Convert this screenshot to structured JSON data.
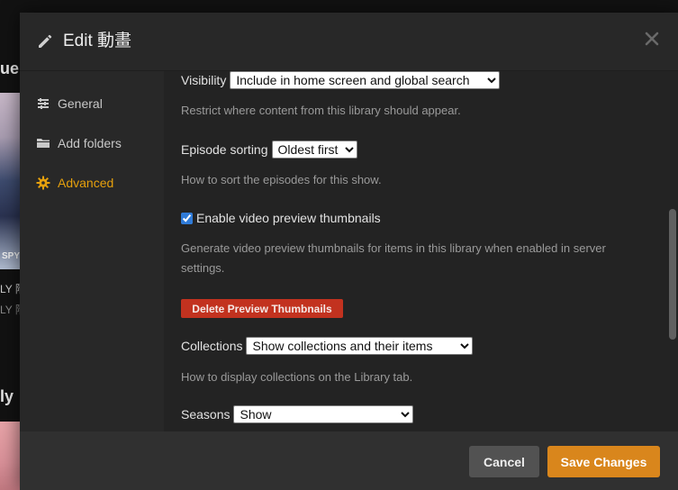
{
  "background": {
    "fragment_1": "ue",
    "fragment_2": "ly",
    "caption_1": "LY 階",
    "caption_2": "LY 階",
    "poster_text": "SPY"
  },
  "modal": {
    "title": "Edit 動畫",
    "title_icon": "pencil-icon",
    "close_icon": "close-icon"
  },
  "sidebar": {
    "items": [
      {
        "label": "General",
        "icon": "sliders-icon",
        "active": false
      },
      {
        "label": "Add folders",
        "icon": "folder-icon",
        "active": false
      },
      {
        "label": "Advanced",
        "icon": "gear-icon",
        "active": true
      }
    ]
  },
  "advanced": {
    "visibility": {
      "label": "Visibility",
      "value": "Include in home screen and global search",
      "help": "Restrict where content from this library should appear."
    },
    "episode_sorting": {
      "label": "Episode sorting",
      "value": "Oldest first",
      "help": "How to sort the episodes for this show."
    },
    "preview_thumbnails": {
      "label": "Enable video preview thumbnails",
      "checked": true,
      "help": "Generate video preview thumbnails for items in this library when enabled in server settings."
    },
    "delete_button": "Delete Preview Thumbnails",
    "collections": {
      "label": "Collections",
      "value": "Show collections and their items",
      "help": "How to display collections on the Library tab."
    },
    "seasons": {
      "label": "Seasons",
      "value": "Show"
    }
  },
  "footer": {
    "cancel_label": "Cancel",
    "save_label": "Save Changes"
  },
  "colors": {
    "accent": "#e5a00d",
    "danger": "#c2321f",
    "save": "#d9861c"
  }
}
